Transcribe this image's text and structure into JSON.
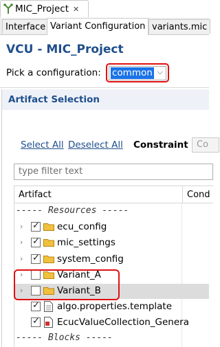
{
  "editor_tab": {
    "title": "MIC_Project",
    "close_glyph": "✕",
    "icon": "project-icon"
  },
  "page_tabs": [
    {
      "label": "Interface",
      "active": false
    },
    {
      "label": "Variant Configuration",
      "active": true
    },
    {
      "label": "variants.mic",
      "active": false
    }
  ],
  "header": {
    "title": "VCU - MIC_Project",
    "pick_label": "Pick a configuration:",
    "config_value": "common"
  },
  "section": {
    "title": "Artifact Selection",
    "select_all": "Select All",
    "deselect_all": "Deselect All",
    "constraint_label": "Constraint :",
    "constraint_value": "Co",
    "filter_placeholder": "type filter text"
  },
  "tree": {
    "columns": [
      "Artifact",
      "Cond"
    ],
    "group_resources": "----- Resources -----",
    "group_blocks": "----- Blocks -----",
    "rows": [
      {
        "label": "ecu_config",
        "checked": true,
        "expandable": true,
        "icon": "folder-icon"
      },
      {
        "label": "mic_settings",
        "checked": true,
        "expandable": true,
        "icon": "folder-icon"
      },
      {
        "label": "system_config",
        "checked": true,
        "expandable": true,
        "icon": "folder-icon"
      },
      {
        "label": "Variant_A",
        "checked": false,
        "expandable": true,
        "icon": "folder-icon"
      },
      {
        "label": "Variant_B",
        "checked": false,
        "expandable": true,
        "icon": "folder-icon",
        "selected": true
      },
      {
        "label": "algo.properties.template",
        "checked": true,
        "expandable": false,
        "icon": "file-icon"
      },
      {
        "label": "EcucValueCollection_Genera",
        "checked": true,
        "expandable": false,
        "icon": "xml-file-icon"
      }
    ]
  },
  "colors": {
    "title_blue": "#1f4e8c",
    "highlight_red": "#e01010",
    "selection_blue": "#1a73e8",
    "folder_yellow": "#f0c040"
  },
  "glyphs": {
    "expander": "›",
    "dropdown": "⌵",
    "check": "✓"
  }
}
